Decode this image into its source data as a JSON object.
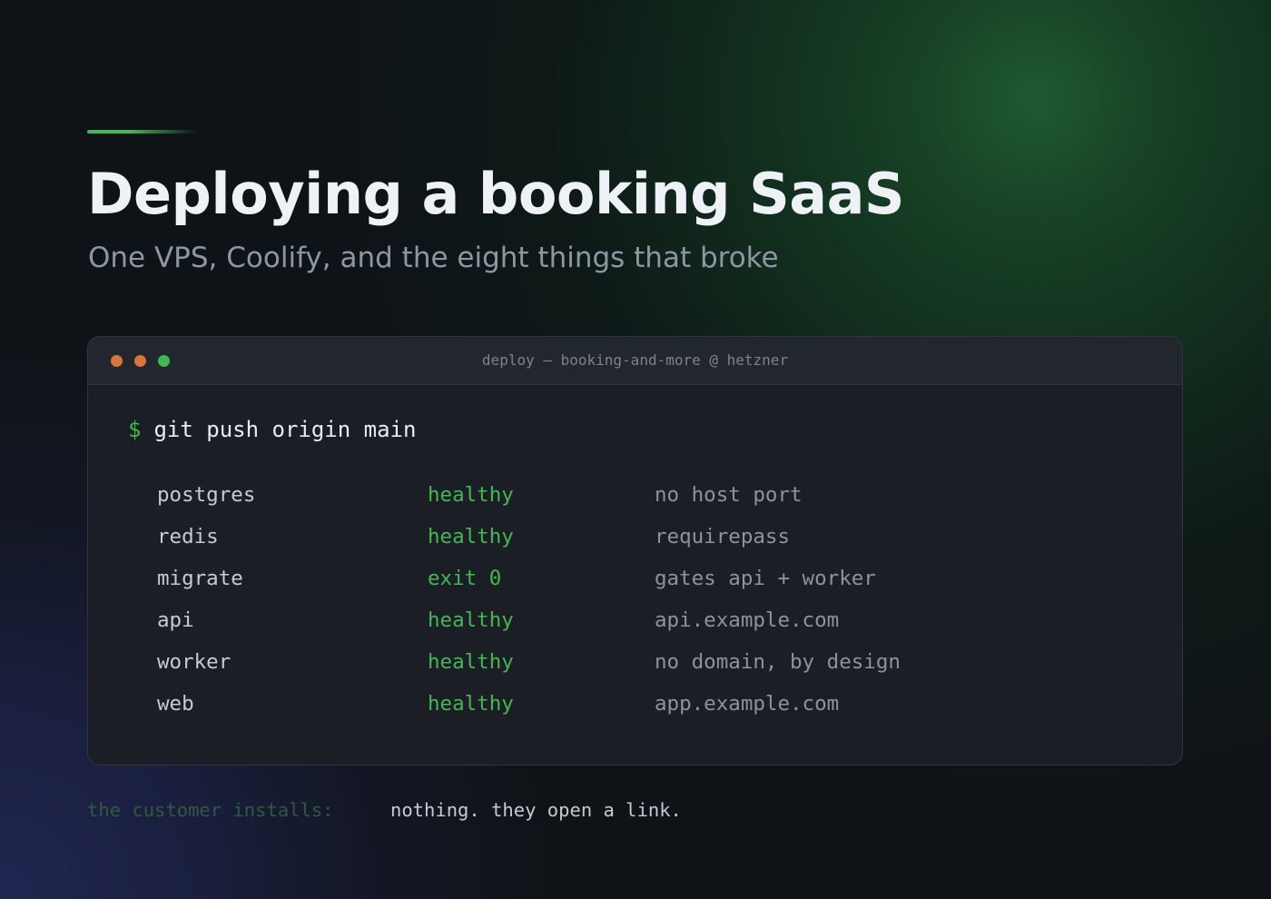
{
  "hero": {
    "title": "Deploying a booking SaaS",
    "subtitle": "One VPS, Coolify, and the eight things that broke"
  },
  "terminal": {
    "window_title": "deploy — booking-and-more @ hetzner",
    "prompt": "$",
    "command": "git push origin main",
    "rows": [
      {
        "service": "postgres",
        "status": "healthy",
        "note": "no host port"
      },
      {
        "service": "redis",
        "status": "healthy",
        "note": "requirepass"
      },
      {
        "service": "migrate",
        "status": "exit 0",
        "note": "gates api + worker"
      },
      {
        "service": "api",
        "status": "healthy",
        "note": "api.example.com"
      },
      {
        "service": "worker",
        "status": "healthy",
        "note": "no domain, by design"
      },
      {
        "service": "web",
        "status": "healthy",
        "note": "app.example.com"
      }
    ]
  },
  "footer": {
    "label": "the customer installs:",
    "value": "nothing. they open a link."
  },
  "colors": {
    "accent_green": "#3fb950",
    "window_dot_orange": "#d9743a",
    "terminal_bg": "#1b1f25",
    "page_bg": "#0e1116"
  },
  "icons": {
    "window_controls": [
      "window-dot-icon",
      "window-dot-icon",
      "window-dot-icon"
    ]
  }
}
